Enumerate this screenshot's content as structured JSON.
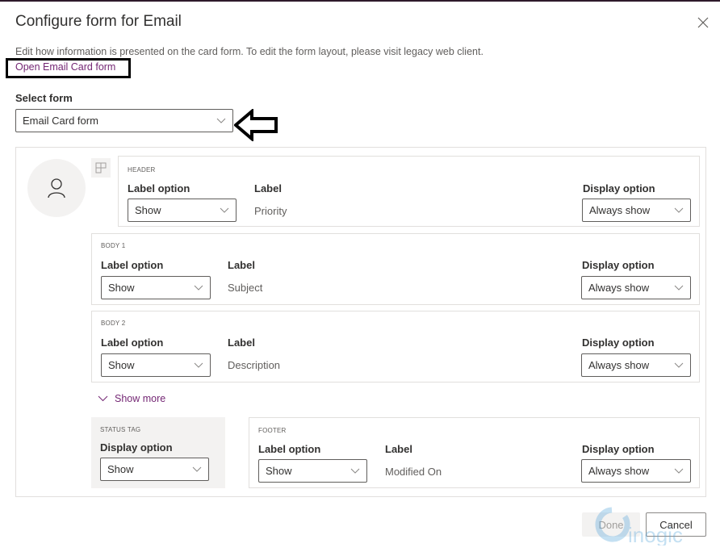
{
  "dialog": {
    "title": "Configure form for Email",
    "description": "Edit how information is presented on the card form. To edit the form layout, please visit legacy web client.",
    "open_link": "Open Email Card form",
    "close_icon": "close-icon"
  },
  "select_form": {
    "label": "Select form",
    "value": "Email Card form"
  },
  "sections": {
    "header": {
      "title": "HEADER",
      "label_option_label": "Label option",
      "label_option_value": "Show",
      "label_label": "Label",
      "label_value": "Priority",
      "display_option_label": "Display option",
      "display_option_value": "Always show"
    },
    "body1": {
      "title": "BODY 1",
      "label_option_label": "Label option",
      "label_option_value": "Show",
      "label_label": "Label",
      "label_value": "Subject",
      "display_option_label": "Display option",
      "display_option_value": "Always show"
    },
    "body2": {
      "title": "BODY 2",
      "label_option_label": "Label option",
      "label_option_value": "Show",
      "label_label": "Label",
      "label_value": "Description",
      "display_option_label": "Display option",
      "display_option_value": "Always show"
    },
    "status_tag": {
      "title": "STATUS TAG",
      "display_option_label": "Display option",
      "display_option_value": "Show"
    },
    "footer": {
      "title": "FOOTER",
      "label_option_label": "Label option",
      "label_option_value": "Show",
      "label_label": "Label",
      "label_value": "Modified On",
      "display_option_label": "Display option",
      "display_option_value": "Always show"
    }
  },
  "show_more": "Show more",
  "buttons": {
    "done": "Done",
    "cancel": "Cancel"
  },
  "watermark": "inogic",
  "colors": {
    "link": "#742774",
    "border": "#e1dfdd",
    "neutral_bg": "#f3f2f1",
    "annotation": "#000000"
  }
}
